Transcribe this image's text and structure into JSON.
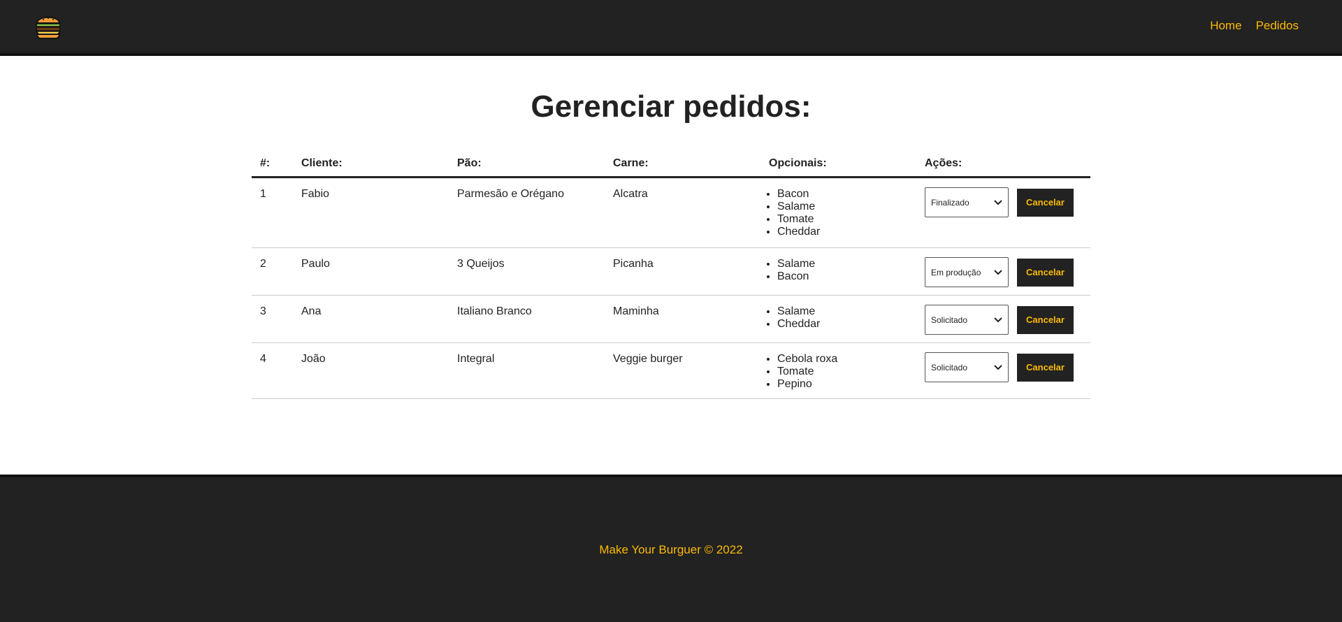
{
  "header": {
    "logo_icon": "burger-icon",
    "nav": [
      {
        "label": "Home"
      },
      {
        "label": "Pedidos"
      }
    ]
  },
  "main": {
    "title": "Gerenciar pedidos:",
    "table": {
      "headers": {
        "id": "#:",
        "cliente": "Cliente:",
        "pao": "Pão:",
        "carne": "Carne:",
        "opcionais": "Opcionais:",
        "acoes": "Ações:"
      },
      "rows": [
        {
          "id": "1",
          "cliente": "Fabio",
          "pao": "Parmesão e Orégano",
          "carne": "Alcatra",
          "opcionais": [
            "Bacon",
            "Salame",
            "Tomate",
            "Cheddar"
          ],
          "status": "Finalizado",
          "cancel_label": "Cancelar"
        },
        {
          "id": "2",
          "cliente": "Paulo",
          "pao": "3 Queijos",
          "carne": "Picanha",
          "opcionais": [
            "Salame",
            "Bacon"
          ],
          "status": "Em produção",
          "cancel_label": "Cancelar"
        },
        {
          "id": "3",
          "cliente": "Ana",
          "pao": "Italiano Branco",
          "carne": "Maminha",
          "opcionais": [
            "Salame",
            "Cheddar"
          ],
          "status": "Solicitado",
          "cancel_label": "Cancelar"
        },
        {
          "id": "4",
          "cliente": "João",
          "pao": "Integral",
          "carne": "Veggie burger",
          "opcionais": [
            "Cebola roxa",
            "Tomate",
            "Pepino"
          ],
          "status": "Solicitado",
          "cancel_label": "Cancelar"
        }
      ]
    }
  },
  "footer": {
    "text": "Make Your Burguer © 2022"
  },
  "colors": {
    "dark": "#222222",
    "accent": "#fcba03",
    "background": "#ffffff"
  }
}
